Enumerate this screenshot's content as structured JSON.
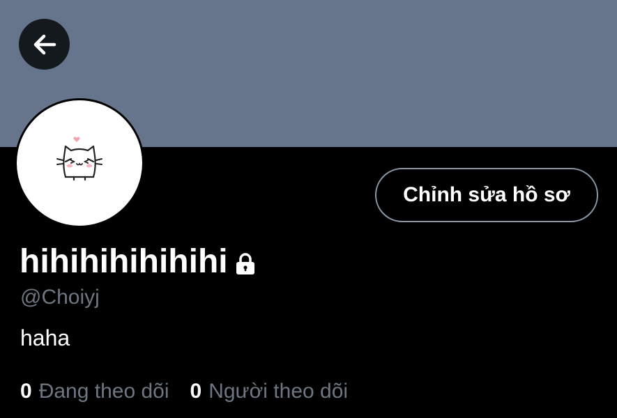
{
  "header": {
    "back_icon": "arrow-left-icon"
  },
  "profile": {
    "avatar_icon": "cat-avatar-icon",
    "edit_button_label": "Chỉnh sửa hồ sơ",
    "display_name": "hihihihihihihi",
    "protected_icon": "lock-icon",
    "handle": "@Choiyj",
    "bio": "haha"
  },
  "stats": {
    "following_count": "0",
    "following_label": "Đang theo dõi",
    "followers_count": "0",
    "followers_label": "Người theo dõi"
  },
  "colors": {
    "banner": "#66758c",
    "background": "#000000",
    "muted_text": "#6e7781",
    "button_border": "#8b98a5"
  }
}
